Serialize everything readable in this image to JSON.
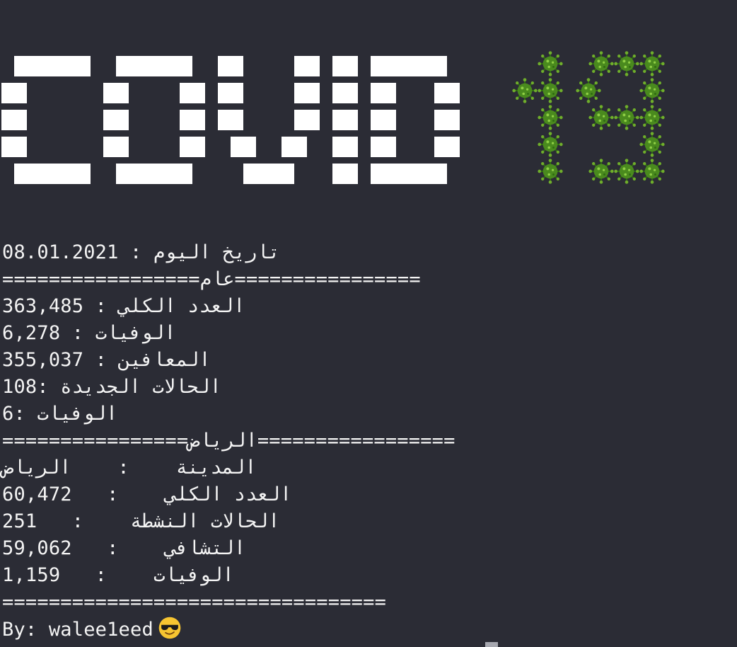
{
  "terminal": {
    "date_label": "تاريخ اليوم",
    "date_value": "08.01.2021",
    "general_header": "عام",
    "general_rule_left": "=================",
    "general_rule_right": "================",
    "total_label": "العدد الكلي",
    "total_value": "363,485",
    "deaths_label": "الوفيات",
    "deaths_value": "6,278",
    "recovered_label": "المعافين",
    "recovered_value": "355,037",
    "new_cases_label": "الحالات الجديدة",
    "new_cases_value": "108:",
    "new_deaths_label": "الوفيات",
    "new_deaths_value": "6:",
    "city_header": "الرياض",
    "city_rule_left": "================",
    "city_rule_right": "=================",
    "city_label": "المدينة",
    "city_value": "الرياض",
    "city_total_label": "العدد الكلي",
    "city_total_value": "60,472",
    "city_active_label": "الحالات النشطة",
    "city_active_value": "251",
    "city_recovered_label": "التشافي",
    "city_recovered_value": "59,062",
    "city_deaths_label": "الوفيات",
    "city_deaths_value": "1,159",
    "bottom_rule": "=================================",
    "byline": "By: walee1eed",
    "emoji_name": "sunglasses-face-emoji"
  },
  "colors": {
    "background": "#2b2c35",
    "text": "#f4f4f4",
    "banner_blocks": "#ffffff",
    "virus_green": "#4a8a1e"
  }
}
